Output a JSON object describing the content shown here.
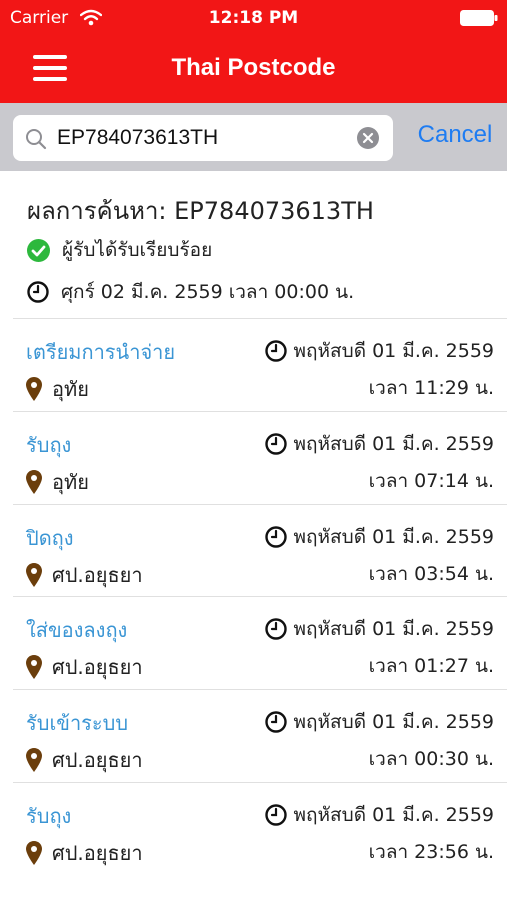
{
  "status_bar": {
    "carrier": "Carrier",
    "time": "12:18 PM"
  },
  "nav": {
    "title": "Thai Postcode"
  },
  "search": {
    "value": "EP784073613TH",
    "cancel_label": "Cancel"
  },
  "summary": {
    "title": "ผลการค้นหา: EP784073613TH",
    "status": "ผู้รับได้รับเรียบร้อย",
    "date": "ศุกร์ 02 มี.ค. 2559 เวลา 00:00 น."
  },
  "colors": {
    "header": "#f21616",
    "status_link": "#3a95d4",
    "success": "#2db83d",
    "pin": "#6b3e0c"
  },
  "events": [
    {
      "status": "เตรียมการนำจ่าย",
      "date": "พฤหัสบดี 01 มี.ค. 2559",
      "place": "อุทัย",
      "time": "เวลา 11:29 น."
    },
    {
      "status": "รับถุง",
      "date": "พฤหัสบดี 01 มี.ค. 2559",
      "place": "อุทัย",
      "time": "เวลา 07:14 น."
    },
    {
      "status": "ปิดถุง",
      "date": "พฤหัสบดี 01 มี.ค. 2559",
      "place": "ศป.อยุธยา",
      "time": "เวลา 03:54 น."
    },
    {
      "status": "ใส่ของลงถุง",
      "date": "พฤหัสบดี 01 มี.ค. 2559",
      "place": "ศป.อยุธยา",
      "time": "เวลา 01:27 น."
    },
    {
      "status": "รับเข้าระบบ",
      "date": "พฤหัสบดี 01 มี.ค. 2559",
      "place": "ศป.อยุธยา",
      "time": "เวลา 00:30 น."
    },
    {
      "status": "รับถุง",
      "date": "พฤหัสบดี 01 มี.ค. 2559",
      "place": "ศป.อยุธยา",
      "time": "เวลา 23:56 น."
    }
  ]
}
